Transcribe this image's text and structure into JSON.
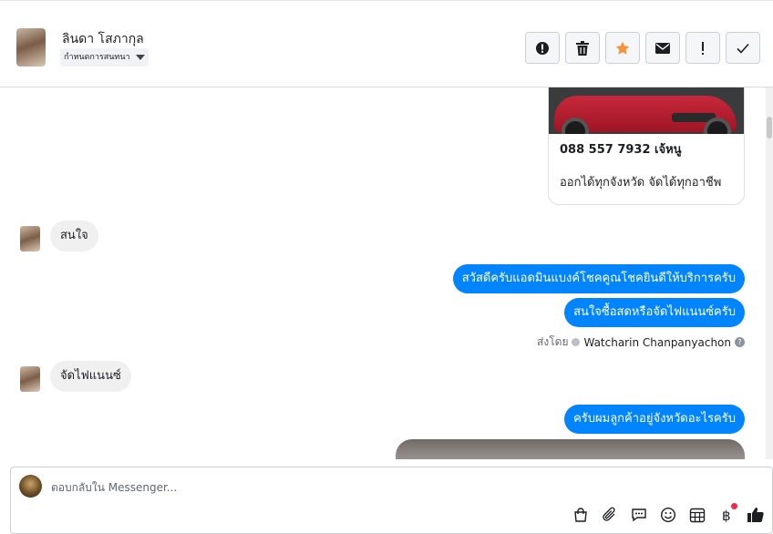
{
  "header": {
    "contact_name": "ลินดา โสภากุล",
    "assign_label": "กำหนดการสนทนา"
  },
  "actions": [
    {
      "name": "mark-spam-button",
      "icon": "alert-circle-icon"
    },
    {
      "name": "delete-button",
      "icon": "trash-icon"
    },
    {
      "name": "star-button",
      "icon": "star-icon",
      "color": "#f7923b"
    },
    {
      "name": "mark-unread-button",
      "icon": "envelope-icon"
    },
    {
      "name": "follow-up-button",
      "icon": "exclamation-icon"
    },
    {
      "name": "mark-done-button",
      "icon": "checkmark-icon"
    }
  ],
  "thread": {
    "card": {
      "title": "088 557 7932 เจ้หนู",
      "description": "ออกได้ทุกจังหวัด จัดได้ทุกอาชีพ"
    },
    "messages": [
      {
        "direction": "in",
        "text": "สนใจ"
      },
      {
        "direction": "out",
        "text": "สวัสดีครับแอดมินแบงค์โชคคูณโชคยินดีให้บริการครับ"
      },
      {
        "direction": "out",
        "text": "สนใจซื้อสดหรือจัดไฟแนนซ์ครับ"
      },
      {
        "direction": "in",
        "text": "จัดไฟแนนซ์"
      },
      {
        "direction": "out",
        "text": "ครับผมลูกค้าอยู่จังหวัดอะไรครับ"
      }
    ],
    "sent_by_label": "ส่งโดย",
    "sent_by_name": "Watcharin Chanpanyachon"
  },
  "composer": {
    "placeholder": "ตอบกลับใน Messenger...",
    "tools": [
      "shop-bag-icon",
      "attachment-icon",
      "saved-reply-icon",
      "emoji-icon",
      "appointment-icon",
      "payment-baht-icon",
      "thumbs-up-icon"
    ]
  },
  "colors": {
    "accent": "#0084ff",
    "star": "#f7923b",
    "badge": "#f02849"
  }
}
